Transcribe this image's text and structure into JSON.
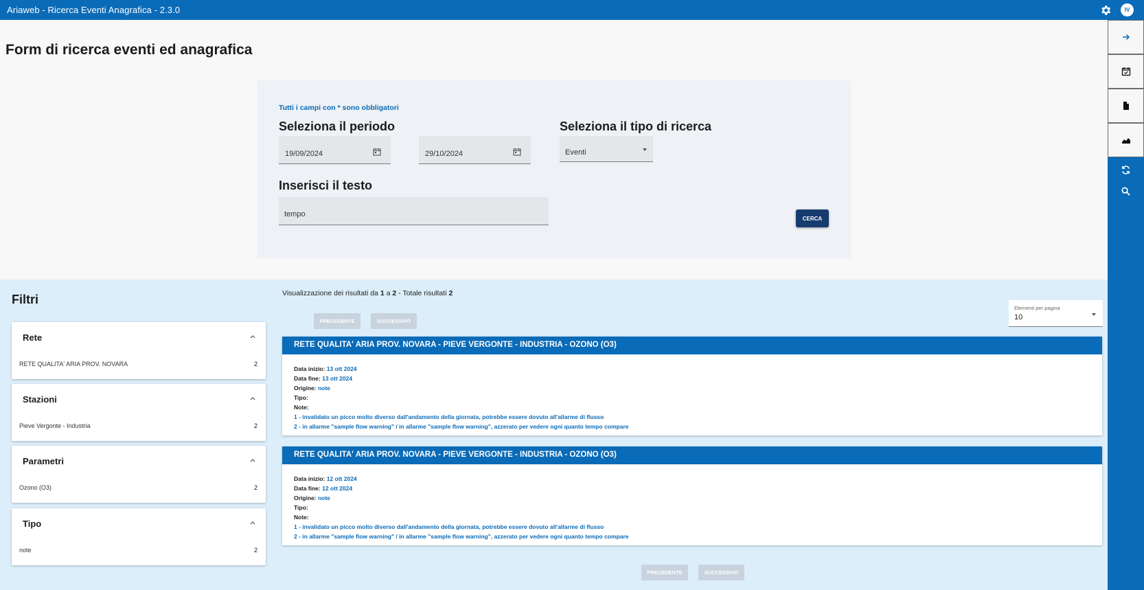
{
  "app": {
    "title": "Ariaweb -  Ricerca Eventi Anagrafica - 2.3.0",
    "avatar_initials": "IV",
    "accent_color": "#0a6bb8",
    "rail_icons": [
      "arrow-right-icon",
      "calendar-check-icon",
      "document-icon",
      "chart-area-icon",
      "refresh-icon",
      "search-icon"
    ]
  },
  "form": {
    "page_title": "Form di ricerca eventi ed anagrafica",
    "required_note": "Tutti i campi con * sono obbligatori",
    "period_heading": "Seleziona il periodo",
    "date_from": "19/09/2024",
    "date_to": "29/10/2024",
    "search_type_heading": "Seleziona il tipo di ricerca",
    "search_type_value": "Eventi",
    "text_heading": "Inserisci il testo",
    "text_value": "tempo",
    "search_button": "CERCA"
  },
  "filters": {
    "title": "Filtri",
    "groups": [
      {
        "title": "Rete",
        "item": "RETE QUALITA' ARIA PROV. NOVARA",
        "count": "2"
      },
      {
        "title": "Stazioni",
        "item": "Pieve Vergonte - Industria",
        "count": "2"
      },
      {
        "title": "Parametri",
        "item": "Ozono (O3)",
        "count": "2"
      },
      {
        "title": "Tipo",
        "item": "note",
        "count": "2"
      }
    ]
  },
  "results": {
    "summary_prefix": "Visualizzazione dei risultati da ",
    "from": "1",
    "summary_mid": " a ",
    "to": "2",
    "summary_total_label": " - Totale risultati ",
    "total": "2",
    "prev_label": "PRECEDENTE",
    "next_label": "SUCCESSIVO",
    "per_page_label": "Elementi per pagina",
    "per_page_value": "10",
    "labels": {
      "start": "Data inizio:",
      "end": "Data fine:",
      "origin": "Origine:",
      "type": "Tipo:",
      "notes": "Note:"
    },
    "items": [
      {
        "header": "RETE QUALITA' ARIA PROV. NOVARA - PIEVE VERGONTE - INDUSTRIA - OZONO (O3)",
        "start": "13 ott 2024",
        "end": "13 ott 2024",
        "origin": "note",
        "note1": "1 - invalidato un picco molto diverso dall'andamento della giornata, potrebbe essere dovuto all'allarme di flusso",
        "note2": "2 - in allarme \"sample flow warning\" / in allarme \"sample flow warning\", azzerato per vedere ogni quanto tempo compare"
      },
      {
        "header": "RETE QUALITA' ARIA PROV. NOVARA - PIEVE VERGONTE - INDUSTRIA - OZONO (O3)",
        "start": "12 ott 2024",
        "end": "12 ott 2024",
        "origin": "note",
        "note1": "1 - invalidato un picco molto diverso dall'andamento della giornata, potrebbe essere dovuto all'allarme di flusso",
        "note2": "2 - in allarme \"sample flow warning\" / in allarme \"sample flow warning\", azzerato per vedere ogni quanto tempo compare"
      }
    ]
  }
}
